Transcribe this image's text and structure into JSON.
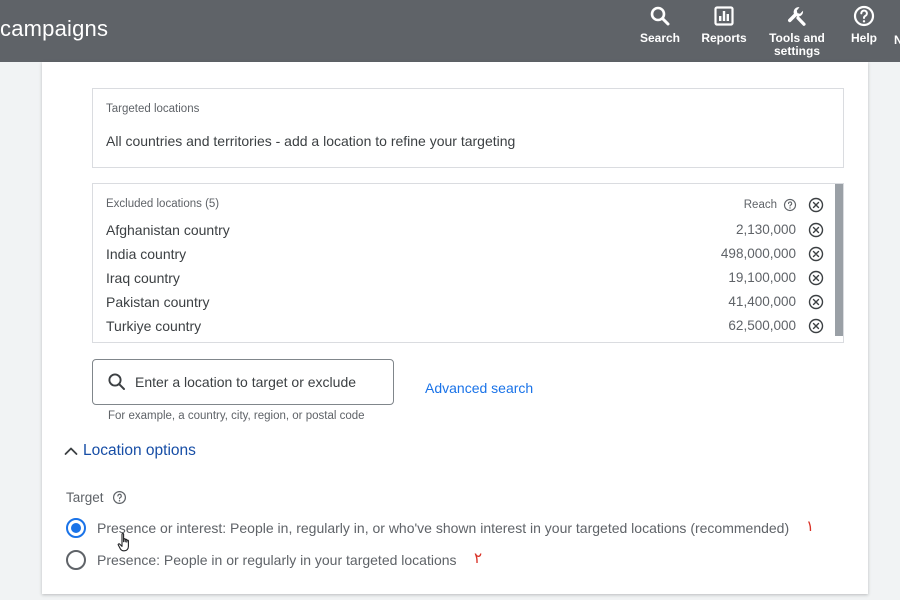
{
  "header": {
    "app_title": "campaigns",
    "nav": {
      "search": "Search",
      "reports": "Reports",
      "tools_line1": "Tools and",
      "tools_line2": "settings",
      "help": "Help",
      "overflow": "N"
    }
  },
  "targeted_locations": {
    "label": "Targeted locations",
    "value": "All countries and territories - add a location to refine your targeting"
  },
  "excluded_locations": {
    "label": "Excluded locations (5)",
    "reach_label": "Reach",
    "rows": [
      {
        "name": "Afghanistan country",
        "reach": "2,130,000"
      },
      {
        "name": "India country",
        "reach": "498,000,000"
      },
      {
        "name": "Iraq country",
        "reach": "19,100,000"
      },
      {
        "name": "Pakistan country",
        "reach": "41,400,000"
      },
      {
        "name": "Turkiye country",
        "reach": "62,500,000"
      }
    ]
  },
  "location_search": {
    "placeholder": "Enter a location to target or exclude",
    "hint": "For example, a country, city, region, or postal code",
    "advanced_search": "Advanced search"
  },
  "location_options": {
    "toggle_label": "Location options",
    "target_label": "Target",
    "options": [
      {
        "label": "Presence or interest: People in, regularly in, or who've shown interest in your targeted locations (recommended)",
        "selected": true,
        "annotation": "١"
      },
      {
        "label": "Presence: People in or regularly in your targeted locations",
        "selected": false,
        "annotation": "٢"
      }
    ]
  },
  "colors": {
    "topbar": "#5f6368",
    "accent": "#1a73e8",
    "link": "#174ea6",
    "annotation": "#d93025"
  },
  "icons": [
    "search-icon",
    "reports-icon",
    "wrench-icon",
    "help-icon",
    "remove-icon",
    "magnifier-icon",
    "chevron-up-icon",
    "info-icon",
    "hand-cursor-icon"
  ]
}
